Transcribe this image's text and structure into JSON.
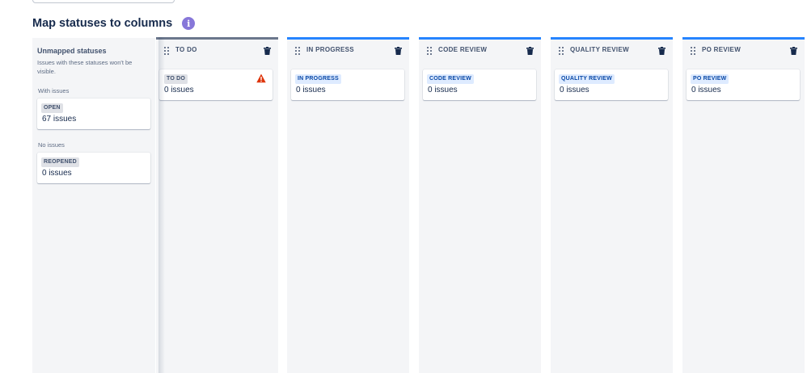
{
  "header": {
    "title": "Map statuses to columns",
    "info_icon": "i"
  },
  "unmapped": {
    "title": "Unmapped statuses",
    "description": "Issues with these statuses won't be visible.",
    "groups": [
      {
        "label": "With issues",
        "status": "OPEN",
        "count": "67 issues"
      },
      {
        "label": "No issues",
        "status": "REOPENED",
        "count": "0 issues"
      }
    ]
  },
  "columns": [
    {
      "title": "TO DO",
      "status": "TO DO",
      "count": "0 issues",
      "warning": true
    },
    {
      "title": "IN PROGRESS",
      "status": "IN PROGRESS",
      "count": "0 issues"
    },
    {
      "title": "CODE REVIEW",
      "status": "CODE REVIEW",
      "count": "0 issues"
    },
    {
      "title": "QUALITY REVIEW",
      "status": "QUALITY REVIEW",
      "count": "0 issues"
    },
    {
      "title": "PO REVIEW",
      "status": "PO REVIEW",
      "count": "0 issues"
    }
  ],
  "colors": {
    "accent": "#2684ff",
    "first_column_top": "#6b778c",
    "info": "#8777d9",
    "warning": "#de350b",
    "lozenge_blue_text": "#0747a6",
    "lozenge_blue_bg": "#deebff"
  }
}
